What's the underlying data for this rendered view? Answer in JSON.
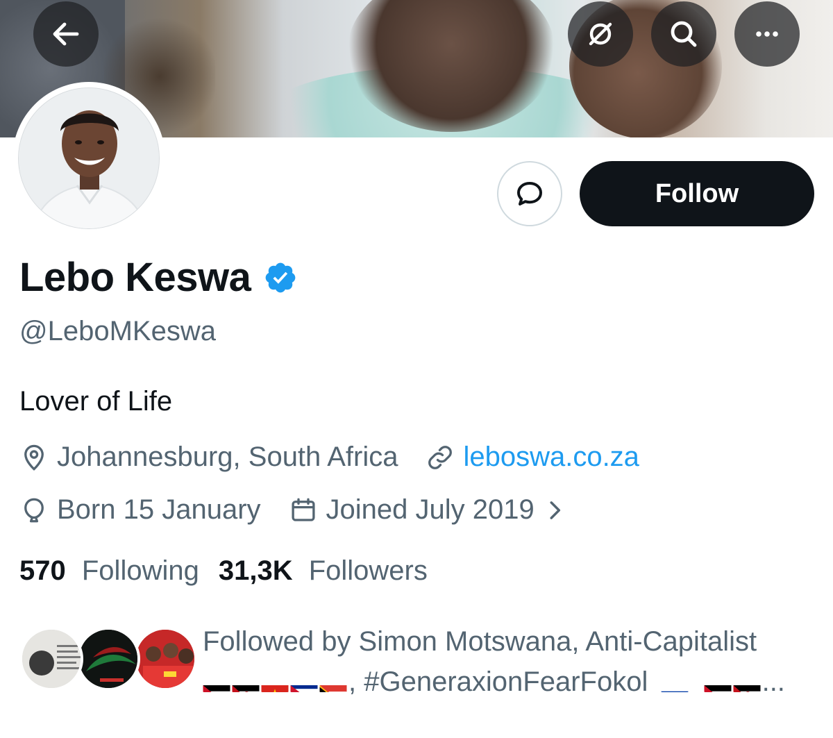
{
  "header": {
    "back_icon": "arrow-left-icon",
    "grok_icon": "slash-circle-icon",
    "search_icon": "search-icon",
    "more_icon": "more-horizontal-icon"
  },
  "profile": {
    "name": "Lebo Keswa",
    "verified": true,
    "handle": "@LeboMKeswa",
    "bio": "Lover of Life",
    "location": "Johannesburg, South Africa",
    "website": "leboswa.co.za",
    "birthday": "Born 15 January",
    "joined": "Joined July 2019"
  },
  "actions": {
    "follow_label": "Follow",
    "message_icon": "message-bubble-icon"
  },
  "stats": {
    "following_count": "570",
    "following_label": "Following",
    "followers_count": "31,3K",
    "followers_label": "Followers"
  },
  "followed_by": {
    "line1": "Followed by Simon Motswana, Anti-Capitalist",
    "line2_text": ", #GeneraxionFearFokol",
    "ellipsis": "..."
  },
  "colors": {
    "accent": "#1d9bf0",
    "primary_text": "#0f1419",
    "secondary_text": "#536471",
    "follow_button_bg": "#0f1419"
  }
}
